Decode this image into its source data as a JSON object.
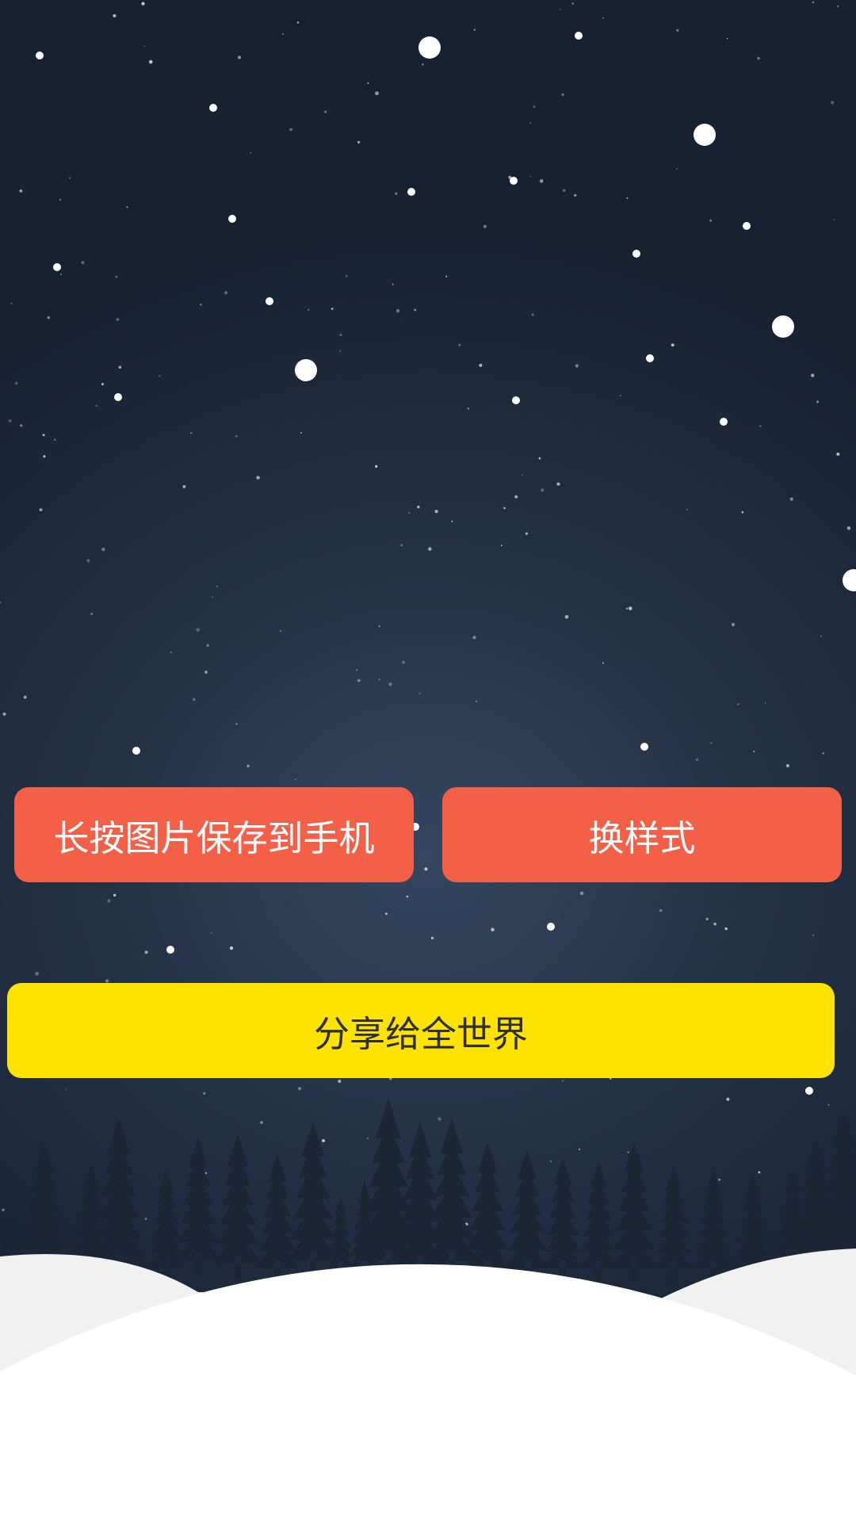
{
  "theme": {
    "sky_top": "#172132",
    "sky_glow": "#34475f",
    "tree_color": "#1d2636",
    "snow_back": "#f1f1f1",
    "snow_front": "#ffffff",
    "primary_button": "#f45f48",
    "share_button": "#ffe300"
  },
  "actions": {
    "save_label": "长按图片保存到手机",
    "change_style_label": "换样式",
    "share_label": "分享给全世界"
  }
}
